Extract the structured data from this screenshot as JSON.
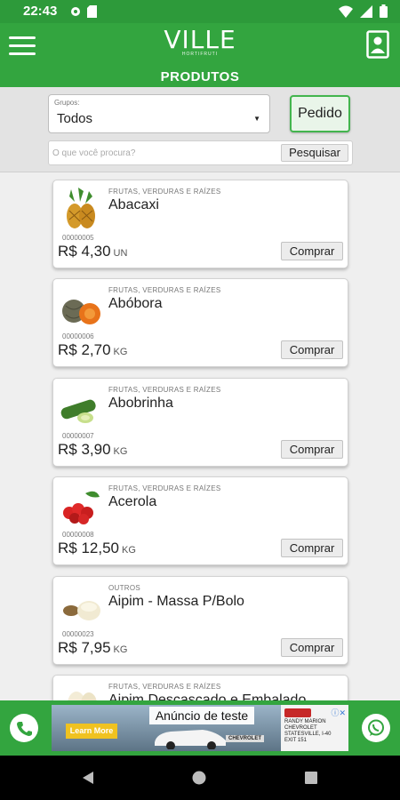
{
  "status_bar": {
    "time": "22:43"
  },
  "app_bar": {
    "logo_name": "VILLE",
    "logo_sub": "HORTIFRUTI",
    "title": "PRODUTOS"
  },
  "filters": {
    "group_label": "Grupos:",
    "group_value": "Todos",
    "order_button": "Pedido",
    "search_placeholder": "O que você procura?",
    "search_button": "Pesquisar"
  },
  "products": [
    {
      "category": "FRUTAS, VERDURAS E RAÍZES",
      "name": "Abacaxi",
      "code": "00000005",
      "price": "R$ 4,30",
      "unit": "UN",
      "buy": "Comprar",
      "icon": "pineapple-icon"
    },
    {
      "category": "FRUTAS, VERDURAS E RAÍZES",
      "name": "Abóbora",
      "code": "00000006",
      "price": "R$ 2,70",
      "unit": "KG",
      "buy": "Comprar",
      "icon": "pumpkin-icon"
    },
    {
      "category": "FRUTAS, VERDURAS E RAÍZES",
      "name": "Abobrinha",
      "code": "00000007",
      "price": "R$ 3,90",
      "unit": "KG",
      "buy": "Comprar",
      "icon": "zucchini-icon"
    },
    {
      "category": "FRUTAS, VERDURAS E RAÍZES",
      "name": "Acerola",
      "code": "00000008",
      "price": "R$ 12,50",
      "unit": "KG",
      "buy": "Comprar",
      "icon": "acerola-icon"
    },
    {
      "category": "OUTROS",
      "name": "Aipim - Massa P/Bolo",
      "code": "00000023",
      "price": "R$ 7,95",
      "unit": "KG",
      "buy": "Comprar",
      "icon": "cassava-dough-icon"
    },
    {
      "category": "FRUTAS, VERDURAS E RAÍZES",
      "name": "Aipim Descascado e Embalado",
      "code": "",
      "price": "",
      "unit": "",
      "buy": "",
      "icon": "cassava-icon"
    }
  ],
  "ad": {
    "label": "Anúncio de teste",
    "learn_more": "Learn More",
    "dealer": "RANDY MARION\nCHEVROLET\nSTATESVILLE, I-40\nEXIT 151",
    "brand": "CHEVROLET"
  },
  "colors": {
    "primary": "#33a53f",
    "status": "#2d9a3a",
    "accent_border": "#43b54e"
  }
}
